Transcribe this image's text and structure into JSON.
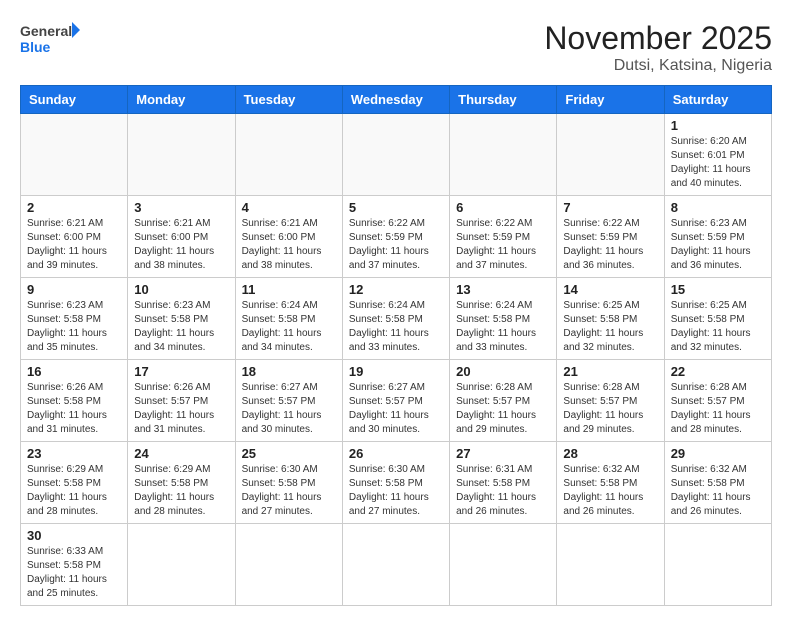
{
  "header": {
    "logo_general": "General",
    "logo_blue": "Blue",
    "title": "November 2025",
    "subtitle": "Dutsi, Katsina, Nigeria"
  },
  "days_of_week": [
    "Sunday",
    "Monday",
    "Tuesday",
    "Wednesday",
    "Thursday",
    "Friday",
    "Saturday"
  ],
  "weeks": [
    [
      {
        "day": "",
        "info": ""
      },
      {
        "day": "",
        "info": ""
      },
      {
        "day": "",
        "info": ""
      },
      {
        "day": "",
        "info": ""
      },
      {
        "day": "",
        "info": ""
      },
      {
        "day": "",
        "info": ""
      },
      {
        "day": "1",
        "info": "Sunrise: 6:20 AM\nSunset: 6:01 PM\nDaylight: 11 hours\nand 40 minutes."
      }
    ],
    [
      {
        "day": "2",
        "info": "Sunrise: 6:21 AM\nSunset: 6:00 PM\nDaylight: 11 hours\nand 39 minutes."
      },
      {
        "day": "3",
        "info": "Sunrise: 6:21 AM\nSunset: 6:00 PM\nDaylight: 11 hours\nand 38 minutes."
      },
      {
        "day": "4",
        "info": "Sunrise: 6:21 AM\nSunset: 6:00 PM\nDaylight: 11 hours\nand 38 minutes."
      },
      {
        "day": "5",
        "info": "Sunrise: 6:22 AM\nSunset: 5:59 PM\nDaylight: 11 hours\nand 37 minutes."
      },
      {
        "day": "6",
        "info": "Sunrise: 6:22 AM\nSunset: 5:59 PM\nDaylight: 11 hours\nand 37 minutes."
      },
      {
        "day": "7",
        "info": "Sunrise: 6:22 AM\nSunset: 5:59 PM\nDaylight: 11 hours\nand 36 minutes."
      },
      {
        "day": "8",
        "info": "Sunrise: 6:23 AM\nSunset: 5:59 PM\nDaylight: 11 hours\nand 36 minutes."
      }
    ],
    [
      {
        "day": "9",
        "info": "Sunrise: 6:23 AM\nSunset: 5:58 PM\nDaylight: 11 hours\nand 35 minutes."
      },
      {
        "day": "10",
        "info": "Sunrise: 6:23 AM\nSunset: 5:58 PM\nDaylight: 11 hours\nand 34 minutes."
      },
      {
        "day": "11",
        "info": "Sunrise: 6:24 AM\nSunset: 5:58 PM\nDaylight: 11 hours\nand 34 minutes."
      },
      {
        "day": "12",
        "info": "Sunrise: 6:24 AM\nSunset: 5:58 PM\nDaylight: 11 hours\nand 33 minutes."
      },
      {
        "day": "13",
        "info": "Sunrise: 6:24 AM\nSunset: 5:58 PM\nDaylight: 11 hours\nand 33 minutes."
      },
      {
        "day": "14",
        "info": "Sunrise: 6:25 AM\nSunset: 5:58 PM\nDaylight: 11 hours\nand 32 minutes."
      },
      {
        "day": "15",
        "info": "Sunrise: 6:25 AM\nSunset: 5:58 PM\nDaylight: 11 hours\nand 32 minutes."
      }
    ],
    [
      {
        "day": "16",
        "info": "Sunrise: 6:26 AM\nSunset: 5:58 PM\nDaylight: 11 hours\nand 31 minutes."
      },
      {
        "day": "17",
        "info": "Sunrise: 6:26 AM\nSunset: 5:57 PM\nDaylight: 11 hours\nand 31 minutes."
      },
      {
        "day": "18",
        "info": "Sunrise: 6:27 AM\nSunset: 5:57 PM\nDaylight: 11 hours\nand 30 minutes."
      },
      {
        "day": "19",
        "info": "Sunrise: 6:27 AM\nSunset: 5:57 PM\nDaylight: 11 hours\nand 30 minutes."
      },
      {
        "day": "20",
        "info": "Sunrise: 6:28 AM\nSunset: 5:57 PM\nDaylight: 11 hours\nand 29 minutes."
      },
      {
        "day": "21",
        "info": "Sunrise: 6:28 AM\nSunset: 5:57 PM\nDaylight: 11 hours\nand 29 minutes."
      },
      {
        "day": "22",
        "info": "Sunrise: 6:28 AM\nSunset: 5:57 PM\nDaylight: 11 hours\nand 28 minutes."
      }
    ],
    [
      {
        "day": "23",
        "info": "Sunrise: 6:29 AM\nSunset: 5:58 PM\nDaylight: 11 hours\nand 28 minutes."
      },
      {
        "day": "24",
        "info": "Sunrise: 6:29 AM\nSunset: 5:58 PM\nDaylight: 11 hours\nand 28 minutes."
      },
      {
        "day": "25",
        "info": "Sunrise: 6:30 AM\nSunset: 5:58 PM\nDaylight: 11 hours\nand 27 minutes."
      },
      {
        "day": "26",
        "info": "Sunrise: 6:30 AM\nSunset: 5:58 PM\nDaylight: 11 hours\nand 27 minutes."
      },
      {
        "day": "27",
        "info": "Sunrise: 6:31 AM\nSunset: 5:58 PM\nDaylight: 11 hours\nand 26 minutes."
      },
      {
        "day": "28",
        "info": "Sunrise: 6:32 AM\nSunset: 5:58 PM\nDaylight: 11 hours\nand 26 minutes."
      },
      {
        "day": "29",
        "info": "Sunrise: 6:32 AM\nSunset: 5:58 PM\nDaylight: 11 hours\nand 26 minutes."
      }
    ],
    [
      {
        "day": "30",
        "info": "Sunrise: 6:33 AM\nSunset: 5:58 PM\nDaylight: 11 hours\nand 25 minutes."
      },
      {
        "day": "",
        "info": ""
      },
      {
        "day": "",
        "info": ""
      },
      {
        "day": "",
        "info": ""
      },
      {
        "day": "",
        "info": ""
      },
      {
        "day": "",
        "info": ""
      },
      {
        "day": "",
        "info": ""
      }
    ]
  ]
}
